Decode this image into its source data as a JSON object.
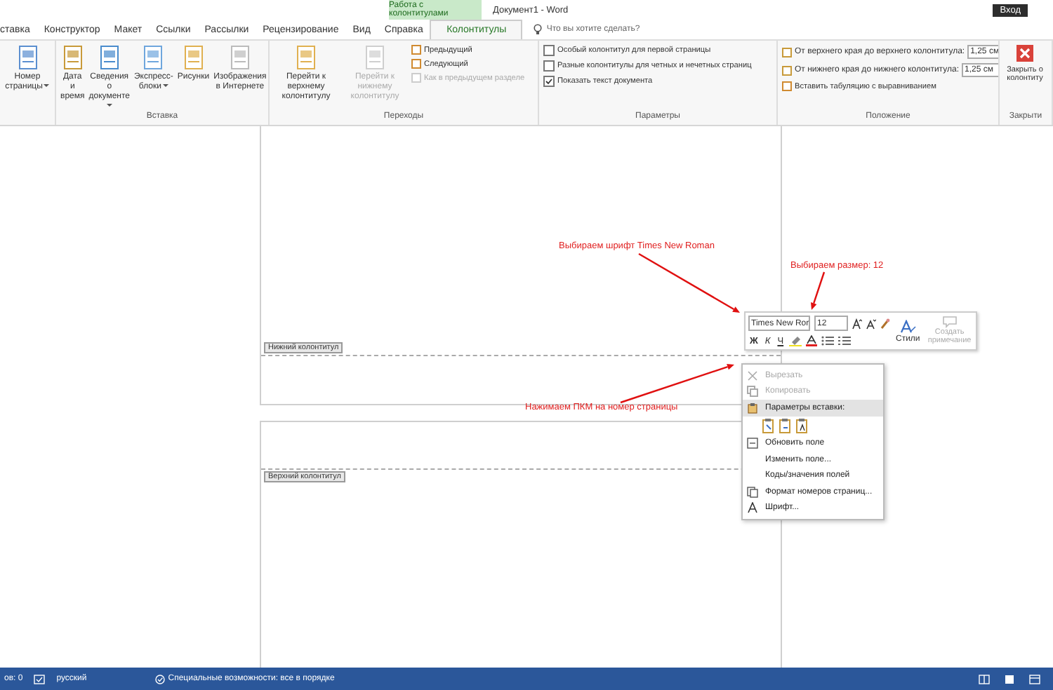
{
  "title_bar": {
    "context_tab": "Работа с колонтитулами",
    "document_title": "Документ1  -  Word",
    "sign_in": "Вход"
  },
  "tabs": [
    {
      "label": "ставка",
      "selected": false
    },
    {
      "label": "Конструктор",
      "selected": false
    },
    {
      "label": "Макет",
      "selected": false
    },
    {
      "label": "Ссылки",
      "selected": false
    },
    {
      "label": "Рассылки",
      "selected": false
    },
    {
      "label": "Рецензирование",
      "selected": false
    },
    {
      "label": "Вид",
      "selected": false
    },
    {
      "label": "Справка",
      "selected": false
    },
    {
      "label": "Колонтитулы",
      "selected": true
    }
  ],
  "tell_me": {
    "placeholder": "Что вы хотите сделать?"
  },
  "ribbon_groups": [
    {
      "items": [
        {
          "kind": "large",
          "label": "Номер страницы",
          "dropdown": true,
          "disabled": false
        }
      ]
    },
    {
      "label": "Вставка",
      "items": [
        {
          "kind": "large",
          "label": "Дата и время",
          "dropdown": false,
          "disabled": false
        },
        {
          "kind": "large",
          "label": "Сведения о документе",
          "dropdown": true,
          "disabled": false
        },
        {
          "kind": "large",
          "label": "Экспресс-блоки",
          "dropdown": true,
          "disabled": false
        },
        {
          "kind": "large",
          "label": "Рисунки",
          "dropdown": false,
          "disabled": false
        },
        {
          "kind": "large",
          "label": "Изображения в Интернете",
          "dropdown": false,
          "disabled": false
        }
      ]
    },
    {
      "label": "Переходы",
      "items": [
        {
          "kind": "large",
          "label": "Перейти к верхнему колонтитулу",
          "dropdown": false,
          "disabled": false
        },
        {
          "kind": "large",
          "label": "Перейти к нижнему колонтитулу",
          "dropdown": false,
          "disabled": true
        },
        {
          "kind": "small",
          "label": "Предыдущий",
          "disabled": false
        },
        {
          "kind": "small",
          "label": "Следующий",
          "disabled": false
        },
        {
          "kind": "small",
          "label": "Как в предыдущем разделе",
          "disabled": true
        }
      ]
    },
    {
      "label": "Параметры",
      "items": [
        {
          "kind": "checkbox",
          "label": "Особый колонтитул для первой страницы",
          "checked": false
        },
        {
          "kind": "checkbox",
          "label": "Разные колонтитулы для четных и нечетных страниц",
          "checked": false
        },
        {
          "kind": "checkbox",
          "label": "Показать текст документа",
          "checked": true
        }
      ]
    },
    {
      "label": "Положение",
      "items": [
        {
          "kind": "spin",
          "label": "От верхнего края до верхнего колонтитула:",
          "value": "1,25 см"
        },
        {
          "kind": "spin",
          "label": "От нижнего края до нижнего колонтитула:",
          "value": "1,25 см"
        },
        {
          "kind": "small",
          "label": "Вставить табуляцию с выравниванием",
          "disabled": false
        }
      ]
    },
    {
      "label": "Закрыти",
      "items": [
        {
          "kind": "close",
          "label": "Закрыть о колонтиту"
        }
      ]
    }
  ],
  "document": {
    "footer_label": "Нижний колонтитул",
    "header_label": "Верхний колонтитул"
  },
  "annotations": [
    {
      "text": "Выбираем шрифт Times New Roman"
    },
    {
      "text": "Выбираем размер: 12"
    },
    {
      "text": "Нажимаем ПКМ на номер страницы"
    }
  ],
  "mini_toolbar": {
    "font": "Times New Ror",
    "size": "12",
    "bold": "Ж",
    "italic": "К",
    "underline": "Ч",
    "styles": "Стили",
    "new_comment": {
      "label": "Создать примечание",
      "disabled": true
    }
  },
  "context_menu": [
    {
      "kind": "item",
      "label": "Вырезать",
      "disabled": true,
      "selected": false
    },
    {
      "kind": "item",
      "label": "Копировать",
      "disabled": true,
      "selected": false
    },
    {
      "kind": "item",
      "label": "Параметры вставки:",
      "disabled": false,
      "selected": true
    },
    {
      "kind": "paste_options"
    },
    {
      "kind": "item",
      "label": "Обновить поле",
      "disabled": false,
      "selected": false
    },
    {
      "kind": "item",
      "label": "Изменить поле...",
      "disabled": false,
      "selected": false
    },
    {
      "kind": "item",
      "label": "Коды/значения полей",
      "disabled": false,
      "selected": false
    },
    {
      "kind": "item",
      "label": "Формат номеров страниц...",
      "disabled": false,
      "selected": false
    },
    {
      "kind": "item",
      "label": "Шрифт...",
      "disabled": false,
      "selected": false
    }
  ],
  "status_bar": {
    "words": "ов: 0",
    "language": "русский",
    "accessibility": "Специальные возможности: все в порядке"
  }
}
